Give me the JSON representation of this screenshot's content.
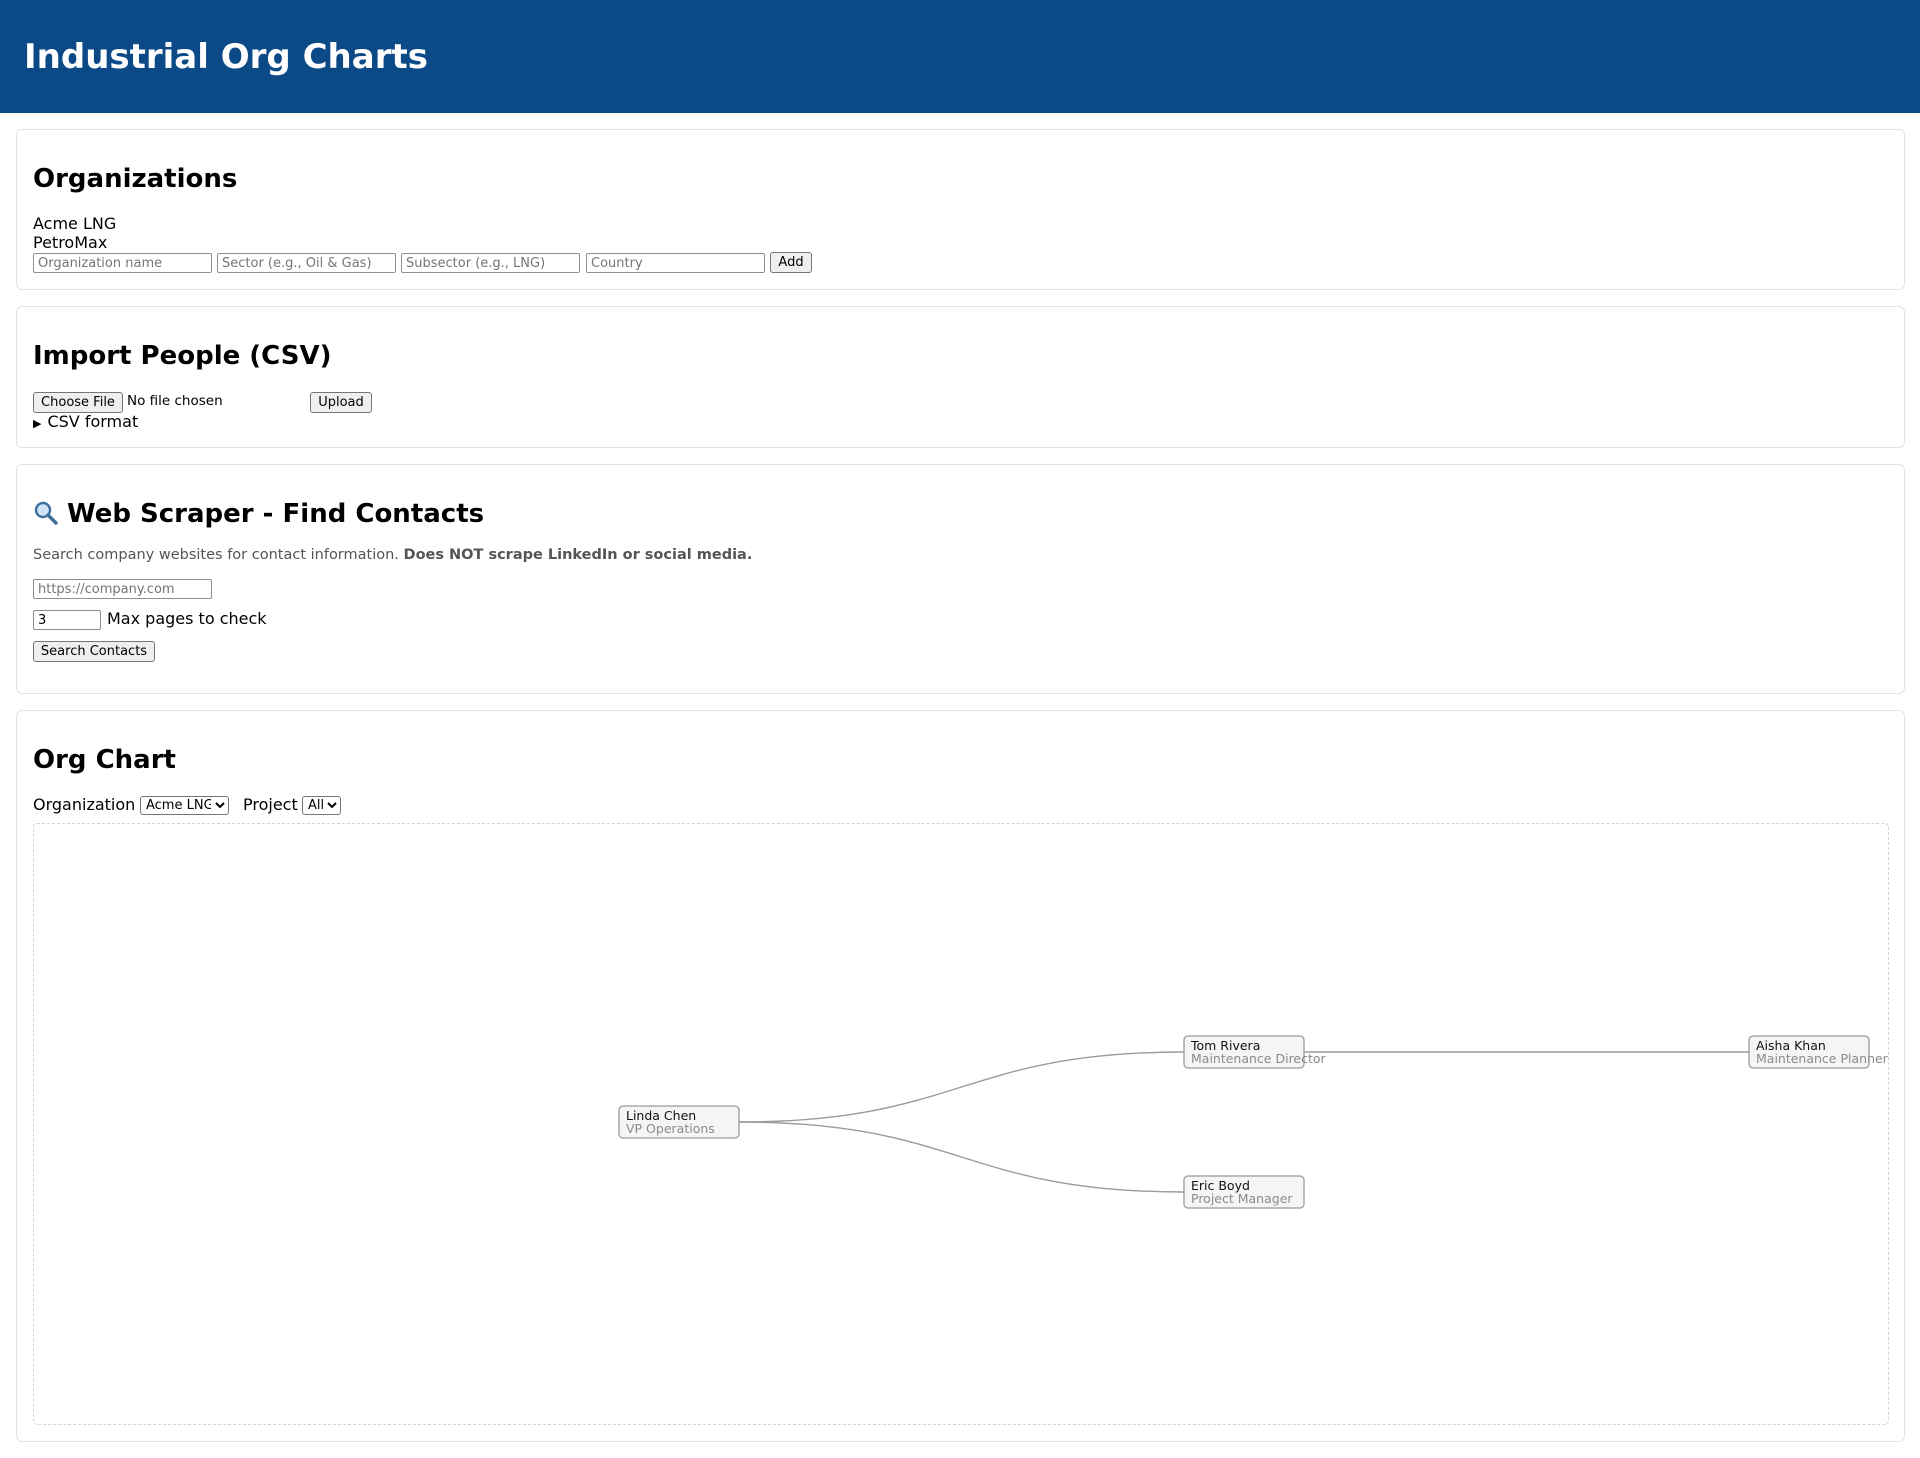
{
  "app": {
    "title": "Industrial Org Charts"
  },
  "organizations": {
    "heading": "Organizations",
    "list": [
      "Acme LNG",
      "PetroMax"
    ],
    "form": {
      "name_placeholder": "Organization name",
      "sector_placeholder": "Sector (e.g., Oil & Gas)",
      "subsector_placeholder": "Subsector (e.g., LNG)",
      "country_placeholder": "Country",
      "add_label": "Add"
    }
  },
  "import": {
    "heading": "Import People (CSV)",
    "choose_file_label": "Choose File",
    "file_status": "No file chosen",
    "upload_label": "Upload",
    "details_summary": "CSV format"
  },
  "scraper": {
    "icon": "magnifier-icon",
    "heading": "Web Scraper - Find Contacts",
    "description": "Search company websites for contact information.",
    "warning": "Does NOT scrape LinkedIn or social media.",
    "url_placeholder": "https://company.com",
    "max_pages_value": "3",
    "max_pages_label": "Max pages to check",
    "search_label": "Search Contacts"
  },
  "orgchart": {
    "heading": "Org Chart",
    "organization_label": "Organization",
    "organization_selected": "Acme LNG",
    "project_label": "Project",
    "project_selected": "All",
    "people": [
      {
        "id": "linda",
        "name": "Linda Chen",
        "title": "VP Operations",
        "manager": null
      },
      {
        "id": "tom",
        "name": "Tom Rivera",
        "title": "Maintenance Director",
        "manager": "linda"
      },
      {
        "id": "eric",
        "name": "Eric Boyd",
        "title": "Project Manager",
        "manager": "linda"
      },
      {
        "id": "aisha",
        "name": "Aisha Khan",
        "title": "Maintenance Planner",
        "manager": "tom"
      }
    ]
  },
  "colors": {
    "header_bg": "#0c4a87",
    "node_fill": "#f5f5f7",
    "link_stroke": "#9a9aa0"
  }
}
